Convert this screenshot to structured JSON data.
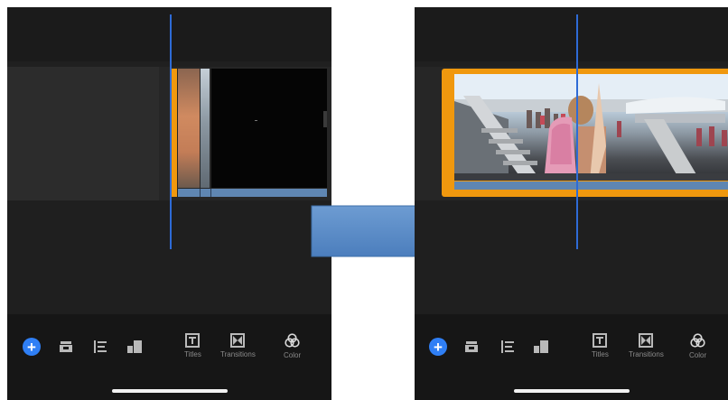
{
  "left_panel": {
    "tools": [
      {
        "icon": "add-icon"
      },
      {
        "icon": "split-clip-icon"
      },
      {
        "icon": "align-clip-icon"
      },
      {
        "icon": "clip-layers-icon"
      },
      {
        "icon": "titles-icon",
        "label": "Titles"
      },
      {
        "icon": "transitions-icon",
        "label": "Transitions"
      },
      {
        "icon": "color-icon",
        "label": "Color"
      }
    ]
  },
  "right_panel": {
    "tools": [
      {
        "icon": "add-icon"
      },
      {
        "icon": "split-clip-icon"
      },
      {
        "icon": "align-clip-icon"
      },
      {
        "icon": "clip-layers-icon"
      },
      {
        "icon": "titles-icon",
        "label": "Titles"
      },
      {
        "icon": "transitions-icon",
        "label": "Transitions"
      },
      {
        "icon": "color-icon",
        "label": "Color"
      }
    ]
  },
  "colors": {
    "playhead": "#2e6bd6",
    "selection": "#f0980e",
    "add_button": "#2f7ff5",
    "arrow": "#4f86c6"
  }
}
